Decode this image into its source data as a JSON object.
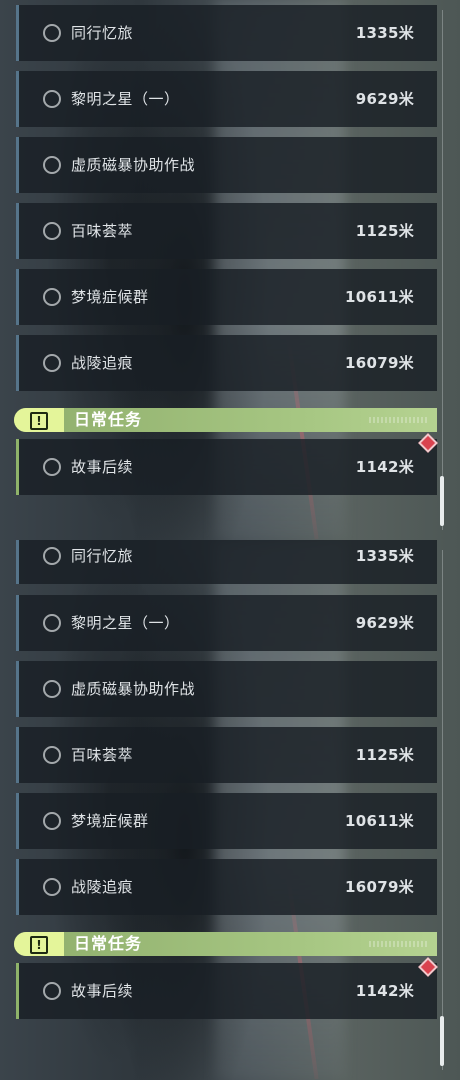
{
  "quests": [
    {
      "name": "同行忆旅",
      "distance": "1335米"
    },
    {
      "name": "黎明之星（一）",
      "distance": "9629米"
    },
    {
      "name": "虚质磁暴协助作战",
      "distance": ""
    },
    {
      "name": "百味荟萃",
      "distance": "1125米"
    },
    {
      "name": "梦境症候群",
      "distance": "10611米"
    },
    {
      "name": "战陵追痕",
      "distance": "16079米"
    }
  ],
  "daily_section": {
    "title": "日常任务",
    "icon": "alert-icon",
    "icon_glyph": "!"
  },
  "daily_quests": [
    {
      "name": "故事后续",
      "distance": "1142米"
    }
  ],
  "colors": {
    "row_accent": "#56748a",
    "daily_accent": "#8fb36a",
    "header_bg": "#a7c783",
    "badge_bg": "#e4f59a",
    "marker": "#d9434f"
  }
}
